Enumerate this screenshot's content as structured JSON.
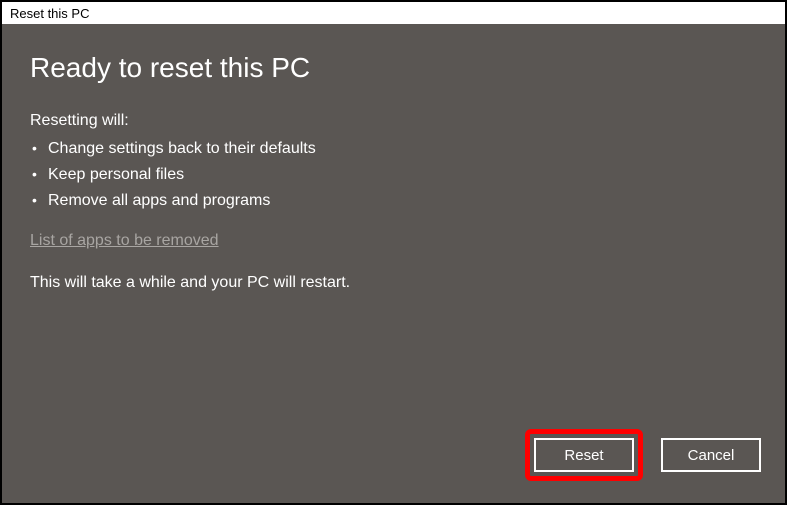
{
  "window": {
    "title": "Reset this PC"
  },
  "main": {
    "heading": "Ready to reset this PC",
    "subheading": "Resetting will:",
    "bullets": [
      "Change settings back to their defaults",
      "Keep personal files",
      "Remove all apps and programs"
    ],
    "link": "List of apps to be removed",
    "note": "This will take a while and your PC will restart."
  },
  "buttons": {
    "reset": "Reset",
    "cancel": "Cancel"
  }
}
